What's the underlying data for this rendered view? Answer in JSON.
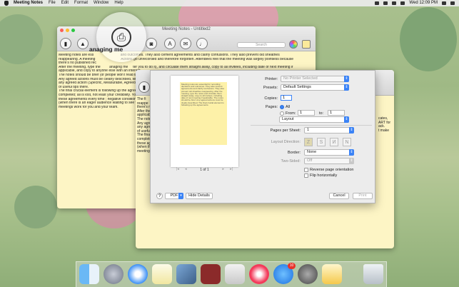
{
  "menubar": {
    "app_name": "Meeting Notes",
    "menus": [
      "File",
      "Edit",
      "Format",
      "Window",
      "Help"
    ],
    "clock": "Wed 12:09 PM"
  },
  "main_window": {
    "title": "Meeting Notes - Untitled2",
    "search_placeholder": "Search",
    "zoom_caption": "anaging me",
    "body_lines": [
      "Meeting notes are ess                           and outcomes. They also cement agreements and clarify confusions. They also prevent old sheathes",
      "reappearing. A meeting                          Actions go unrecorded and therefore forgotten. Attendees feel that the meeting was largely pointless because",
      "there's no published rec",
      "After the meeting, type the         anaging me     ter you to do it), and circulate them straight away, copy to all invitees, including date of next meeting if",
      "applicable, and copy to anyone else with an interest.",
      "The notes should be brief (or people won't read them)",
      "Any agreed actions must be clearly described, with ...",
      "any agreed action (Specific, Measurable, Agreed, ...",
      "of useful tips there.",
      "The final crucial element is following up the agree...",
      "completed; all is lost, not least your credibility. You...",
      "these agreements every time ; negative conditions...",
      "(when there is an eager audience waiting to see w...",
      "meetings work for you and your team."
    ]
  },
  "second_window": {
    "body_lines": [
      "The fi",
      "reappe",
      "there's no",
      "After the",
      "applicabl",
      "The note",
      "Any agre",
      "any agre",
      "of useful",
      "The final",
      "complete",
      "these ag",
      "(when th",
      "meetings"
    ],
    "right_lines": [
      "cates,",
      "ART for",
      "ack.",
      "t make"
    ]
  },
  "print_dialog": {
    "printer_label": "Printer:",
    "printer_value": "No Printer Selected",
    "presets_label": "Presets:",
    "presets_value": "Default Settings",
    "copies_label": "Copies:",
    "copies_value": "1",
    "pages_label": "Pages:",
    "pages_all": "All",
    "pages_from": "From:",
    "pages_from_value": "1",
    "pages_to": "to:",
    "pages_to_value": "1",
    "section_value": "Layout",
    "pages_per_sheet_label": "Pages per Sheet:",
    "pages_per_sheet_value": "1",
    "layout_direction_label": "Layout Direction:",
    "border_label": "Border:",
    "border_value": "None",
    "two_sided_label": "Two-Sided:",
    "two_sided_value": "Off",
    "reverse_label": "Reverse page orientation",
    "flip_label": "Flip horizontally",
    "page_indicator": "1 of 1",
    "pdf_label": "PDF",
    "hide_details": "Hide Details",
    "cancel": "Cancel",
    "print": "Print",
    "help": "?",
    "preview_text": "Meeting notes are essential for recording decisions and outcomes. They also cement agreements and clarify confusions. They also prevent old sheathes reappearing. After the meeting, type the notes and circulate them straight away, copy to all invitees, including date of next meeting if applicable. The notes should be brief. Any agreed actions must be clearly described. The final crucial element is following up the agreements."
  },
  "dock": {
    "badge_count": "10"
  },
  "colors": {
    "accent": "#3b83f6",
    "note_paper": "#fdf5c5"
  }
}
